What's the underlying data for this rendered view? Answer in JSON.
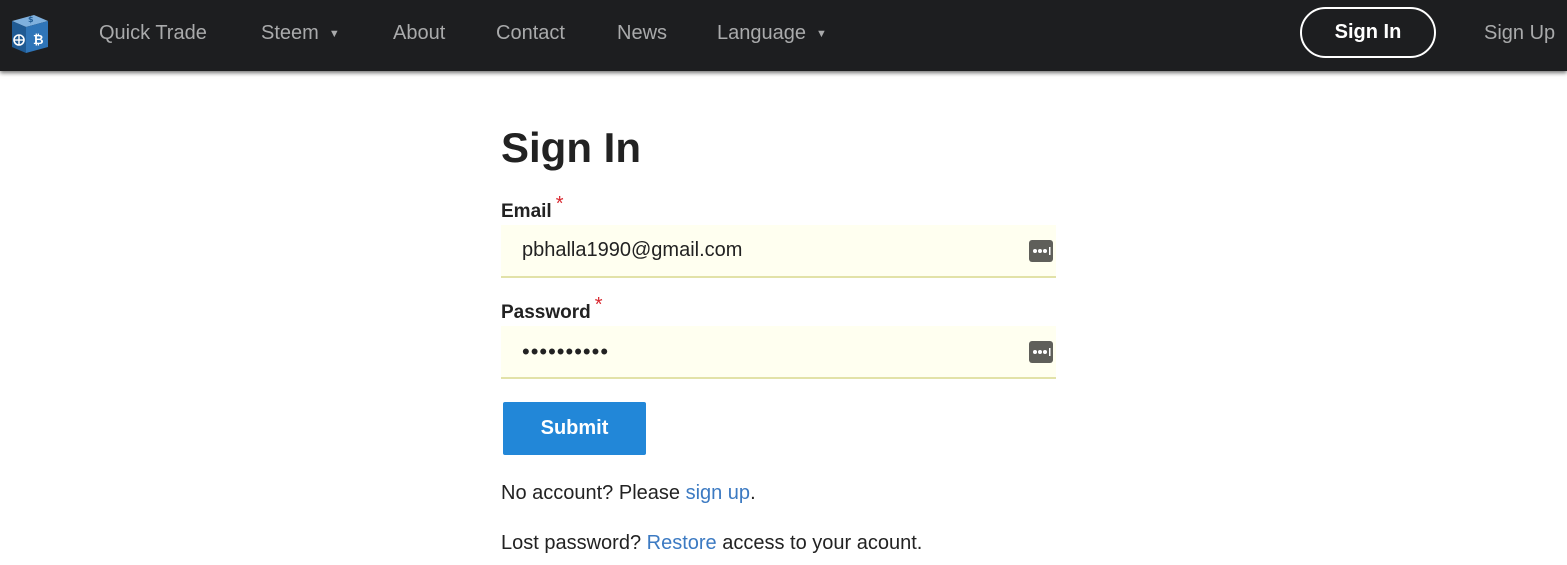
{
  "nav": {
    "items": [
      {
        "label": "Quick Trade"
      },
      {
        "label": "Steem",
        "caret": "▼"
      },
      {
        "label": "About"
      },
      {
        "label": "Contact"
      },
      {
        "label": "News"
      },
      {
        "label": "Language",
        "caret": "▼"
      }
    ],
    "sign_in": "Sign In",
    "sign_up": "Sign Up"
  },
  "form": {
    "title": "Sign In",
    "email_label": "Email",
    "email_value": "pbhalla1990@gmail.com",
    "password_label": "Password",
    "password_value": "••••••••••",
    "required_mark": "*",
    "submit_label": "Submit"
  },
  "help": {
    "signup_prefix": "No account? Please ",
    "signup_link": "sign up",
    "signup_suffix": ".",
    "restore_prefix": "Lost password? ",
    "restore_link": "Restore",
    "restore_suffix": " access to your acount."
  },
  "colors": {
    "navbar_bg": "#1d1e20",
    "nav_text": "#a9aaab",
    "accent": "#2287d8",
    "link": "#3c7ac2",
    "required": "#d8262e",
    "input_bg": "#fffff0"
  },
  "icons": {
    "logo": "cube-logo-icon",
    "dropdown": "caret-down-icon",
    "password_manager": "password-manager-icon"
  }
}
